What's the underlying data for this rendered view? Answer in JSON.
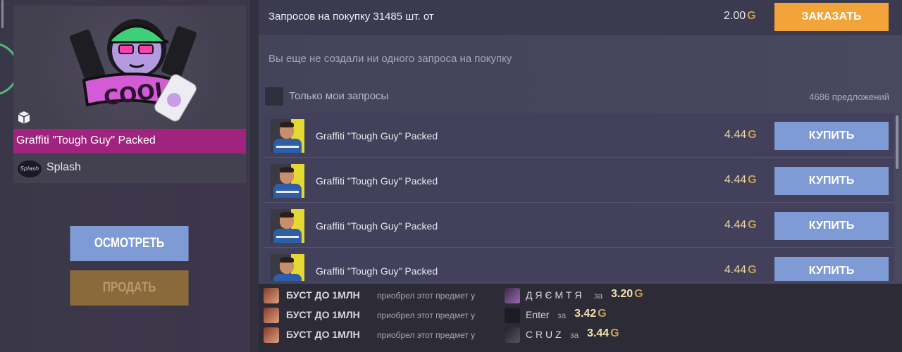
{
  "item": {
    "name": "Graffiti \"Tough Guy\" Packed",
    "collection": "Splash",
    "collection_logo_text": "Splash",
    "name_bar_color": "#a0237e"
  },
  "actions": {
    "inspect_label": "ОСМОТРЕТЬ",
    "sell_label": "ПРОДАТЬ"
  },
  "order": {
    "text": "Запросов на покупку 31485 шт. от",
    "price": "2.00",
    "button_label": "ЗАКАЗАТЬ",
    "button_color": "#f2a33a"
  },
  "empty_message": "Вы еще не создали ни одного запроса на покупку",
  "filter": {
    "mine_label": "Только мои запросы",
    "offers_count": "4686 предложений"
  },
  "listings": [
    {
      "name": "Graffiti \"Tough Guy\" Packed",
      "price": "4.44",
      "button": "КУПИТЬ"
    },
    {
      "name": "Graffiti \"Tough Guy\" Packed",
      "price": "4.44",
      "button": "КУПИТЬ"
    },
    {
      "name": "Graffiti \"Tough Guy\" Packed",
      "price": "4.44",
      "button": "КУПИТЬ"
    },
    {
      "name": "Graffiti \"Tough Guy\" Packed",
      "price": "4.44",
      "button": "КУПИТЬ"
    }
  ],
  "currency_icon": "gold-coin-icon",
  "history": [
    {
      "buyer": "БУСТ ДО 1МЛН",
      "action": "приобрел этот предмет у",
      "seller": "Д Я Є М Т Я",
      "for": "за",
      "price": "3.20"
    },
    {
      "buyer": "БУСТ ДО 1МЛН",
      "action": "приобрел этот предмет у",
      "seller": "Enter",
      "for": "за",
      "price": "3.42"
    },
    {
      "buyer": "БУСТ ДО 1МЛН",
      "action": "приобрел этот предмет у",
      "seller": "C R U Z",
      "for": "за",
      "price": "3.44"
    }
  ],
  "colors": {
    "gold": "#c9a154",
    "buy_button": "#7e9bd6"
  }
}
